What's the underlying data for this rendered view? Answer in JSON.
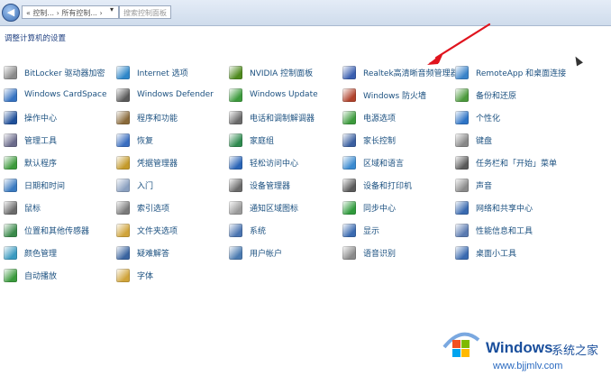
{
  "address_bar": {
    "breadcrumb": "« 控制... › 所有控制... ›",
    "search_placeholder": "搜索控制面板"
  },
  "page_title": "调整计算机的设置",
  "colors": {
    "link": "#1c5180",
    "accent": "#1e3f80",
    "arrow": "#e0141e"
  },
  "items": [
    {
      "label": "BitLocker 驱动器加密",
      "icon": "bitlocker-icon",
      "color": "#8a8a8a"
    },
    {
      "label": "Internet 选项",
      "icon": "internet-options-icon",
      "color": "#2f87c9"
    },
    {
      "label": "NVIDIA 控制面板",
      "icon": "nvidia-icon",
      "color": "#4f8a1e"
    },
    {
      "label": "Realtek高清晰音频管理器",
      "icon": "realtek-audio-icon",
      "color": "#3a5fb0"
    },
    {
      "label": "RemoteApp 和桌面连接",
      "icon": "remoteapp-icon",
      "color": "#3a83c9"
    },
    {
      "label": "Windows CardSpace",
      "icon": "cardspace-icon",
      "color": "#3572c1"
    },
    {
      "label": "Windows Defender",
      "icon": "defender-icon",
      "color": "#5a5a5a"
    },
    {
      "label": "Windows Update",
      "icon": "windows-update-icon",
      "color": "#3c9a3c"
    },
    {
      "label": "Windows 防火墙",
      "icon": "firewall-icon",
      "color": "#b0422b"
    },
    {
      "label": "备份和还原",
      "icon": "backup-icon",
      "color": "#4c9a3c"
    },
    {
      "label": "操作中心",
      "icon": "action-center-icon",
      "color": "#1f4f99"
    },
    {
      "label": "程序和功能",
      "icon": "programs-icon",
      "color": "#8a6a3a"
    },
    {
      "label": "电话和调制解调器",
      "icon": "phone-modem-icon",
      "color": "#6a6a6a"
    },
    {
      "label": "电源选项",
      "icon": "power-icon",
      "color": "#3c9a3c"
    },
    {
      "label": "个性化",
      "icon": "personalization-icon",
      "color": "#2e74c6"
    },
    {
      "label": "管理工具",
      "icon": "admin-tools-icon",
      "color": "#6a6a8a"
    },
    {
      "label": "恢复",
      "icon": "recovery-icon",
      "color": "#3a6ec0"
    },
    {
      "label": "家庭组",
      "icon": "homegroup-icon",
      "color": "#2f8a4f"
    },
    {
      "label": "家长控制",
      "icon": "parental-control-icon",
      "color": "#3a5fa0"
    },
    {
      "label": "键盘",
      "icon": "keyboard-icon",
      "color": "#888888"
    },
    {
      "label": "默认程序",
      "icon": "default-programs-icon",
      "color": "#3d9a3c"
    },
    {
      "label": "凭据管理器",
      "icon": "credential-manager-icon",
      "color": "#c49a2a"
    },
    {
      "label": "轻松访问中心",
      "icon": "ease-of-access-icon",
      "color": "#2a64b6"
    },
    {
      "label": "区域和语言",
      "icon": "region-language-icon",
      "color": "#3a8ad0"
    },
    {
      "label": "任务栏和「开始」菜单",
      "icon": "taskbar-icon",
      "color": "#5a5a5a"
    },
    {
      "label": "日期和时间",
      "icon": "date-time-icon",
      "color": "#3a7ac0"
    },
    {
      "label": "入门",
      "icon": "getting-started-icon",
      "color": "#8aa0c0"
    },
    {
      "label": "设备管理器",
      "icon": "device-manager-icon",
      "color": "#6a6a6a"
    },
    {
      "label": "设备和打印机",
      "icon": "devices-printers-icon",
      "color": "#5a5a5a"
    },
    {
      "label": "声音",
      "icon": "sound-icon",
      "color": "#8a8a8a"
    },
    {
      "label": "鼠标",
      "icon": "mouse-icon",
      "color": "#6a6a6a"
    },
    {
      "label": "索引选项",
      "icon": "indexing-icon",
      "color": "#7a7a7a"
    },
    {
      "label": "通知区域图标",
      "icon": "notification-area-icon",
      "color": "#9a9a9a"
    },
    {
      "label": "同步中心",
      "icon": "sync-center-icon",
      "color": "#2f9a3c"
    },
    {
      "label": "网络和共享中心",
      "icon": "network-sharing-icon",
      "color": "#3a6ab0"
    },
    {
      "label": "位置和其他传感器",
      "icon": "location-sensors-icon",
      "color": "#3a8a4a"
    },
    {
      "label": "文件夹选项",
      "icon": "folder-options-icon",
      "color": "#d0a43a"
    },
    {
      "label": "系统",
      "icon": "system-icon",
      "color": "#4a74b0"
    },
    {
      "label": "显示",
      "icon": "display-icon",
      "color": "#3a6ab0"
    },
    {
      "label": "性能信息和工具",
      "icon": "performance-icon",
      "color": "#5a7ab0"
    },
    {
      "label": "颜色管理",
      "icon": "color-management-icon",
      "color": "#3a9ac0"
    },
    {
      "label": "疑难解答",
      "icon": "troubleshooting-icon",
      "color": "#3a64a0"
    },
    {
      "label": "用户帐户",
      "icon": "user-accounts-icon",
      "color": "#4a7ab0"
    },
    {
      "label": "语音识别",
      "icon": "speech-recognition-icon",
      "color": "#8a8a8a"
    },
    {
      "label": "桌面小工具",
      "icon": "desktop-gadgets-icon",
      "color": "#3a6ab0"
    },
    {
      "label": "自动播放",
      "icon": "autoplay-icon",
      "color": "#3a9a3c"
    },
    {
      "label": "字体",
      "icon": "fonts-icon",
      "color": "#d0a43a"
    }
  ],
  "watermark": {
    "brand": "Windows",
    "cn_name": "系统之家",
    "url": "www.bjjmlv.com"
  }
}
